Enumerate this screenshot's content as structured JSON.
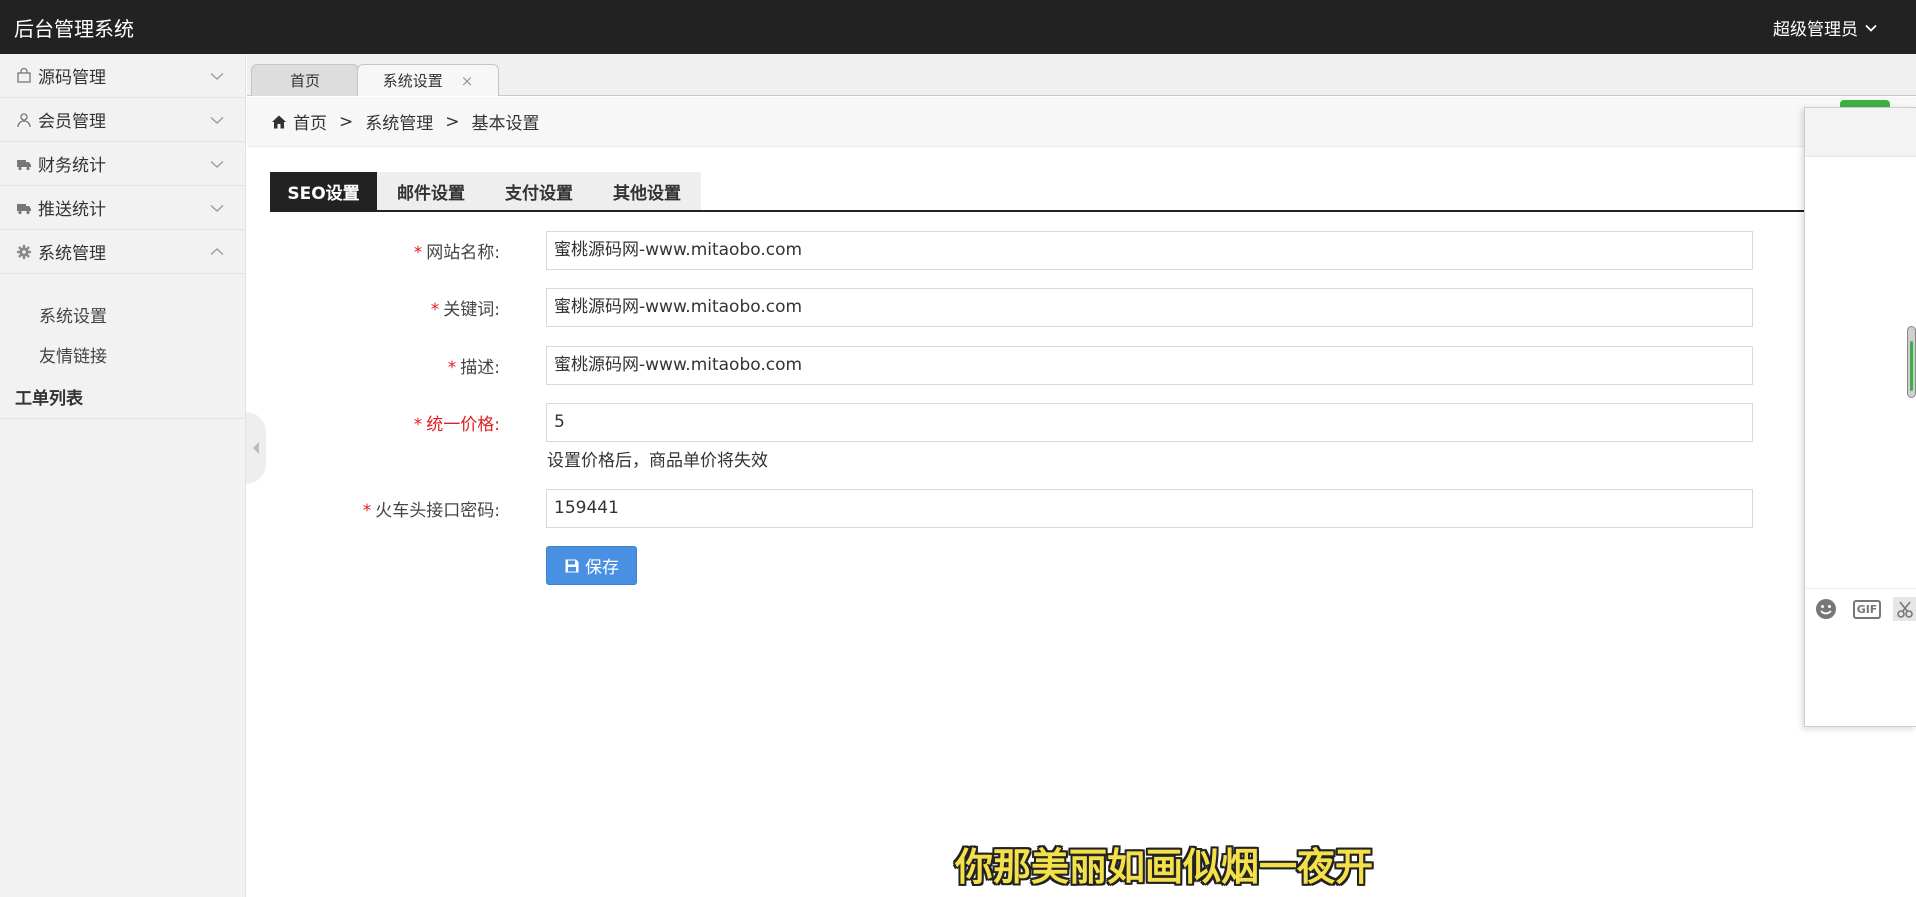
{
  "header": {
    "title": "后台管理系统",
    "user": "超级管理员"
  },
  "sidebar": {
    "items": [
      {
        "label": "源码管理",
        "icon": "bag-icon",
        "expanded": false
      },
      {
        "label": "会员管理",
        "icon": "user-icon",
        "expanded": false
      },
      {
        "label": "财务统计",
        "icon": "truck-icon",
        "expanded": false
      },
      {
        "label": "推送统计",
        "icon": "truck-icon",
        "expanded": false
      },
      {
        "label": "系统管理",
        "icon": "gear-icon",
        "expanded": true
      }
    ],
    "subitems": [
      "系统设置",
      "友情链接"
    ],
    "plain": "工单列表"
  },
  "tabs": [
    {
      "label": "首页"
    },
    {
      "label": "系统设置",
      "close": "×"
    }
  ],
  "breadcrumb": [
    "首页",
    "系统管理",
    "基本设置"
  ],
  "breadcrumb_sep": ">",
  "settings_tabs": [
    "SEO设置",
    "邮件设置",
    "支付设置",
    "其他设置"
  ],
  "form": {
    "required_mark": "*",
    "fields": [
      {
        "label": "网站名称:",
        "value": "蜜桃源码网-www.mitaobo.com"
      },
      {
        "label": "关键词:",
        "value": "蜜桃源码网-www.mitaobo.com"
      },
      {
        "label": "描述:",
        "value": "蜜桃源码网-www.mitaobo.com"
      },
      {
        "label": "统一价格:",
        "value": "5"
      },
      {
        "label": "火车头接口密码:",
        "value": "159441"
      }
    ],
    "price_hint": "设置价格后，商品单价将失效",
    "save_label": "保存"
  },
  "chat": {
    "gif_label": "GIF"
  },
  "subtitle": "你那美丽如画似烟一夜开",
  "colors": {
    "header_bg": "#222222",
    "save_button": "#4a90e2",
    "required": "#e02020",
    "subtitle": "#f4e04a"
  }
}
